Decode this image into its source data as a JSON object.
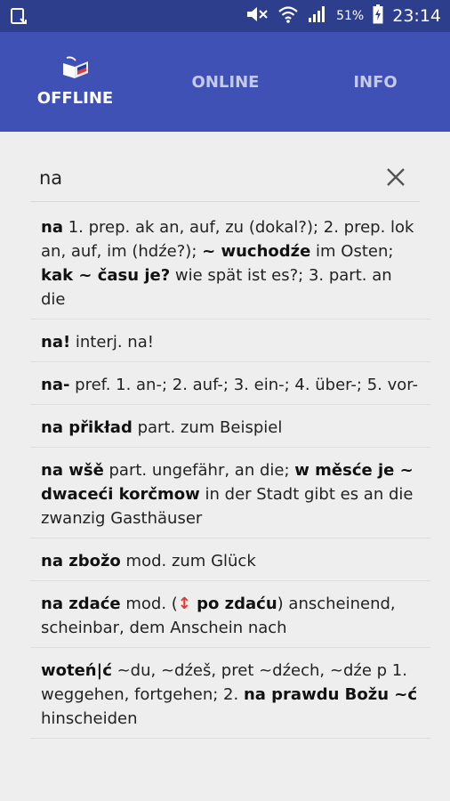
{
  "status": {
    "battery": "51%",
    "time": "23:14"
  },
  "tabs": {
    "offline": "OFFLINE",
    "online": "ONLINE",
    "info": "INFO"
  },
  "search": {
    "value": "na"
  },
  "entries": [
    {
      "parts": [
        {
          "t": "na",
          "b": true
        },
        {
          "t": " 1. prep. ak an, auf, zu (dokal?); 2. prep. lok an, auf, im (hdźe?); "
        },
        {
          "t": "~ wuchodźe",
          "b": true
        },
        {
          "t": " im Osten; "
        },
        {
          "t": "kak ~ času je?",
          "b": true
        },
        {
          "t": " wie spät ist es?; 3. part. an die"
        }
      ]
    },
    {
      "parts": [
        {
          "t": "na!",
          "b": true
        },
        {
          "t": " interj. na!"
        }
      ]
    },
    {
      "parts": [
        {
          "t": "na-",
          "b": true
        },
        {
          "t": " pref. 1. an-; 2. auf-; 3. ein-; 4. über-; 5. vor-"
        }
      ]
    },
    {
      "parts": [
        {
          "t": "na přikład",
          "b": true
        },
        {
          "t": " part. zum Beispiel"
        }
      ]
    },
    {
      "parts": [
        {
          "t": "na wšě",
          "b": true
        },
        {
          "t": " part. ungefähr, an die; "
        },
        {
          "t": "w měsće je ~ dwaceći korčmow",
          "b": true
        },
        {
          "t": " in der Stadt gibt es an die zwanzig Gasthäuser"
        }
      ]
    },
    {
      "parts": [
        {
          "t": "na zbožo",
          "b": true
        },
        {
          "t": " mod. zum Glück"
        }
      ]
    },
    {
      "parts": [
        {
          "t": "na zdaće",
          "b": true
        },
        {
          "t": " mod. ("
        },
        {
          "t": "↕",
          "arrow": true
        },
        {
          "t": " po zdaću",
          "b": true
        },
        {
          "t": ") anscheinend, scheinbar, dem Anschein nach"
        }
      ]
    },
    {
      "parts": [
        {
          "t": "woteń|ć",
          "b": true
        },
        {
          "t": " ~du, ~dźeš, pret ~dźech, ~dźe p 1. weggehen, fortgehen; 2. "
        },
        {
          "t": "na prawdu Božu ~ć",
          "b": true
        },
        {
          "t": " hinscheiden"
        }
      ]
    }
  ],
  "icons": {
    "app": "book-flag-icon",
    "clear": "close-icon",
    "screenshot": "screenshot-icon",
    "mute": "mute-icon",
    "wifi": "wifi-icon",
    "signal": "signal-icon",
    "battery": "battery-charging-icon"
  }
}
